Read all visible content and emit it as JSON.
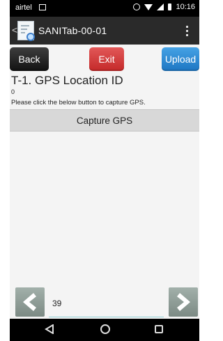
{
  "status_bar": {
    "carrier": "airtel",
    "time": "10:16",
    "icons": [
      "sim-icon",
      "alarm-icon",
      "wifi-icon",
      "signal-icon",
      "battery-icon"
    ]
  },
  "app_bar": {
    "title": "SANITab-00-01",
    "back_glyph": "<",
    "icons": [
      "app-logo-icon",
      "overflow-menu-icon"
    ]
  },
  "actions": {
    "back_label": "Back",
    "exit_label": "Exit",
    "upload_label": "Upload"
  },
  "question": {
    "title": "T-1. GPS Location ID",
    "value": "0",
    "instruction": "Please click the below button to capture GPS."
  },
  "capture_button": {
    "label": "Capture GPS"
  },
  "navigation": {
    "page_number": "39",
    "prev_icon": "chevron-left-icon",
    "next_icon": "chevron-right-icon"
  },
  "system_nav": {
    "icons": [
      "nav-back-icon",
      "nav-home-icon",
      "nav-recents-icon"
    ]
  },
  "colors": {
    "back_button": "#2a2a2a",
    "exit_button": "#d43b3b",
    "upload_button": "#2e8bd6",
    "capture_button": "#d8d8d8",
    "app_bar": "#2a2a2a"
  }
}
